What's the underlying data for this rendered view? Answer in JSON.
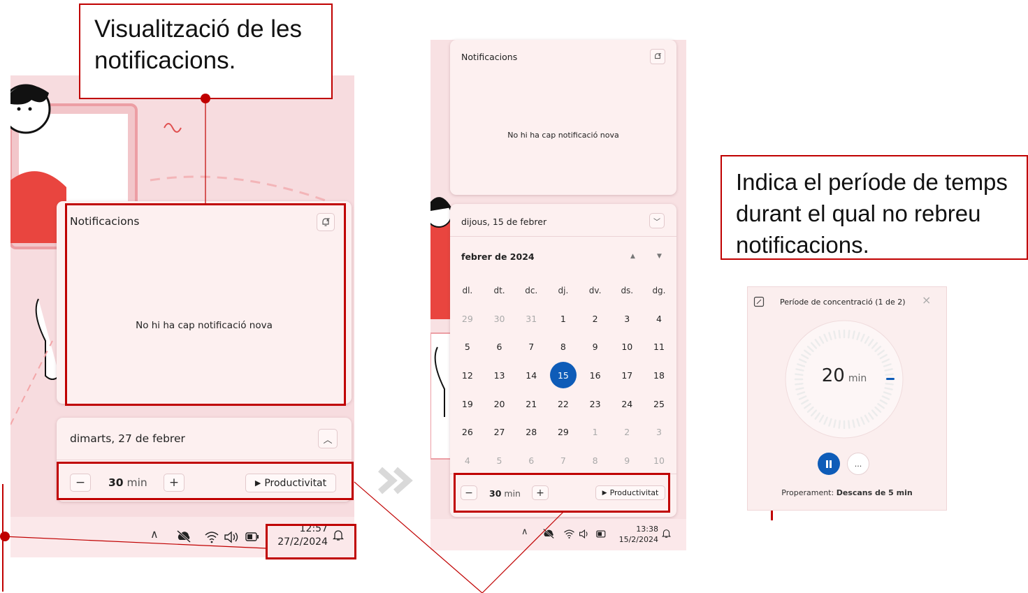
{
  "callouts": {
    "notifications": "Visualització de les notificacions.",
    "focus_period": "Indica el període de temps durant el qual no rebreu notificacions."
  },
  "panel1": {
    "notifications_title": "Notificacions",
    "empty_text": "No hi ha cap notificació nova",
    "date_header": "dimarts, 27 de febrer",
    "focus_value": "30",
    "focus_unit": "min",
    "productivity_label": "Productivitat",
    "minus": "−",
    "plus": "+",
    "time": "12:57",
    "date": "27/2/2024"
  },
  "panel2": {
    "notifications_title": "Notificacions",
    "empty_text": "No hi ha cap notificació nova",
    "date_header": "dijous, 15 de febrer",
    "month_label": "febrer de 2024",
    "weekdays": [
      "dl.",
      "dt.",
      "dc.",
      "dj.",
      "dv.",
      "ds.",
      "dg."
    ],
    "weeks": [
      [
        {
          "d": "29",
          "m": true
        },
        {
          "d": "30",
          "m": true
        },
        {
          "d": "31",
          "m": true
        },
        {
          "d": "1"
        },
        {
          "d": "2"
        },
        {
          "d": "3"
        },
        {
          "d": "4"
        }
      ],
      [
        {
          "d": "5"
        },
        {
          "d": "6"
        },
        {
          "d": "7"
        },
        {
          "d": "8"
        },
        {
          "d": "9"
        },
        {
          "d": "10"
        },
        {
          "d": "11"
        }
      ],
      [
        {
          "d": "12"
        },
        {
          "d": "13"
        },
        {
          "d": "14"
        },
        {
          "d": "15",
          "today": true
        },
        {
          "d": "16"
        },
        {
          "d": "17"
        },
        {
          "d": "18"
        }
      ],
      [
        {
          "d": "19"
        },
        {
          "d": "20"
        },
        {
          "d": "21"
        },
        {
          "d": "22"
        },
        {
          "d": "23"
        },
        {
          "d": "24"
        },
        {
          "d": "25"
        }
      ],
      [
        {
          "d": "26"
        },
        {
          "d": "27"
        },
        {
          "d": "28"
        },
        {
          "d": "29"
        },
        {
          "d": "1",
          "m": true
        },
        {
          "d": "2",
          "m": true
        },
        {
          "d": "3",
          "m": true
        }
      ],
      [
        {
          "d": "4",
          "m": true
        },
        {
          "d": "5",
          "m": true
        },
        {
          "d": "6",
          "m": true
        },
        {
          "d": "7",
          "m": true
        },
        {
          "d": "8",
          "m": true
        },
        {
          "d": "9",
          "m": true
        },
        {
          "d": "10",
          "m": true
        }
      ]
    ],
    "focus_value": "30",
    "focus_unit": "min",
    "productivity_label": "Productivitat",
    "minus": "−",
    "plus": "+",
    "time": "13:38",
    "date": "15/2/2024"
  },
  "panel3": {
    "title": "Període de concentració (1 de 2)",
    "timer_value": "20",
    "timer_unit": "min",
    "more_label": "...",
    "next_prefix": "Properament:",
    "next_value": "Descans de 5 min",
    "timer_progress": 0.0
  },
  "icons": {
    "snooze": "notification-settings-icon",
    "chevron_up": "chevron-up-icon",
    "chevron_down": "chevron-down-icon",
    "bell": "bell-icon"
  },
  "colors": {
    "accent_red": "#c00000",
    "accent_blue": "#0e5cb8",
    "panel_bg": "#fdf0f0"
  }
}
